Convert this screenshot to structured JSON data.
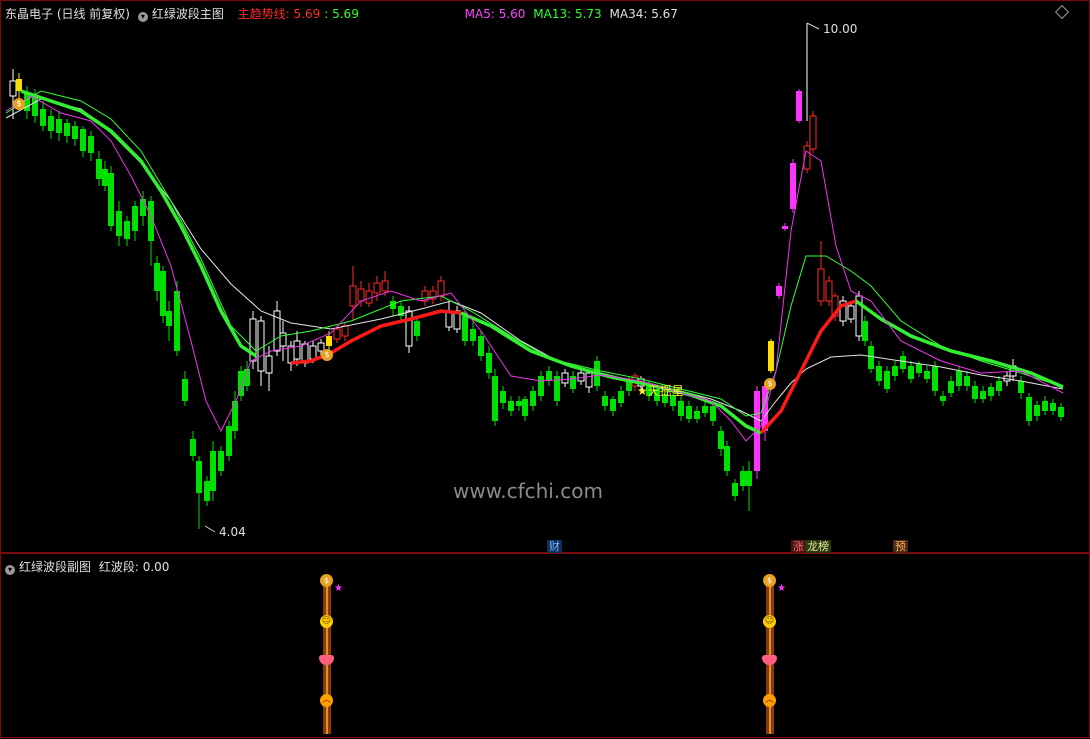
{
  "main_header": {
    "stock": "东晶电子 (日线 前复权)",
    "indicator": "红绿波段主图",
    "trend_label": "主趋势线: 5.69",
    "trend_value2": ": 5.69",
    "ma5": "MA5: 5.60",
    "ma13": "MA13: 5.73",
    "ma34": "MA34: 5.67"
  },
  "sub_header": {
    "indicator": "红绿波段副图",
    "value": "红波段: 0.00"
  },
  "annotations": {
    "high": "10.00",
    "low": "4.04",
    "signal": "★天摇星",
    "watermark": "www.cfchi.com",
    "tag_cai": "财",
    "tag_zhang": "涨",
    "tag_bang": "龙榜",
    "tag_yu": "预"
  },
  "colors": {
    "up": "#ff2a2a",
    "down": "#00e000",
    "white_candle": "#ffffff",
    "magenta": "#ff33ff",
    "ma_green": "#33ff33",
    "trend_red": "#ff1a1a"
  },
  "chart_data": {
    "type": "candlestick",
    "y_axis_markers": {
      "high": 10.0,
      "low": 4.04
    },
    "indicators": {
      "trend_line": 5.69,
      "MA5": 5.6,
      "MA13": 5.73,
      "MA34": 5.67
    },
    "sub_indicator": {
      "红波段": 0.0
    }
  }
}
